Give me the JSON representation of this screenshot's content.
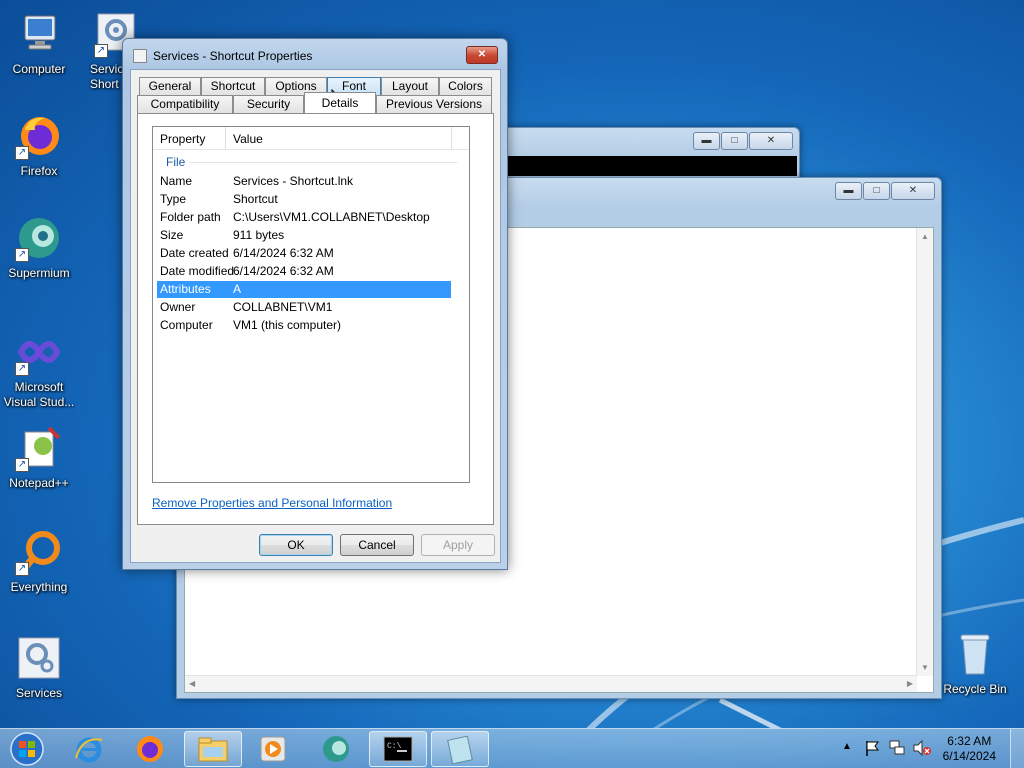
{
  "desktop": {
    "icons": [
      {
        "label": "Computer",
        "icon": "computer-icon"
      },
      {
        "label": "Servic\nShort",
        "icon": "services-shortcut-icon"
      },
      {
        "label": "Firefox",
        "icon": "firefox-icon"
      },
      {
        "label": "Supermium",
        "icon": "supermium-icon"
      },
      {
        "label": "Microsoft\nVisual Stud...",
        "icon": "vscode-icon"
      },
      {
        "label": "Notepad++",
        "icon": "notepadpp-icon"
      },
      {
        "label": "Everything",
        "icon": "everything-icon"
      },
      {
        "label": "Services",
        "icon": "services-icon"
      },
      {
        "label": "Recycle Bin",
        "icon": "recycle-bin-icon"
      }
    ]
  },
  "dialog": {
    "title": "Services - Shortcut Properties",
    "close_label": "✕",
    "tabs_row1": [
      "General",
      "Shortcut",
      "Options",
      "Font",
      "Layout",
      "Colors"
    ],
    "tabs_row2": [
      "Compatibility",
      "Security",
      "Details",
      "Previous Versions"
    ],
    "selected_tab": "Details",
    "columns": {
      "property": "Property",
      "value": "Value"
    },
    "group": "File",
    "rows": [
      {
        "k": "Name",
        "v": "Services - Shortcut.lnk"
      },
      {
        "k": "Type",
        "v": "Shortcut"
      },
      {
        "k": "Folder path",
        "v": "C:\\Users\\VM1.COLLABNET\\Desktop"
      },
      {
        "k": "Size",
        "v": "911 bytes"
      },
      {
        "k": "Date created",
        "v": "6/14/2024 6:32 AM"
      },
      {
        "k": "Date modified",
        "v": "6/14/2024 6:32 AM"
      },
      {
        "k": "Attributes",
        "v": "A"
      },
      {
        "k": "Owner",
        "v": "COLLABNET\\VM1"
      },
      {
        "k": "Computer",
        "v": "VM1 (this computer)"
      }
    ],
    "selected_row": "Attributes",
    "remove_link": "Remove Properties and Personal Information",
    "buttons": {
      "ok": "OK",
      "cancel": "Cancel",
      "apply": "Apply"
    }
  },
  "taskbar": {
    "clock_time": "6:32 AM",
    "clock_date": "6/14/2024",
    "items": [
      "start-orb",
      "internet-explorer-icon",
      "firefox-icon",
      "file-explorer-icon",
      "media-player-icon",
      "supermium-icon",
      "cmd-icon",
      "notepad-icon"
    ]
  }
}
